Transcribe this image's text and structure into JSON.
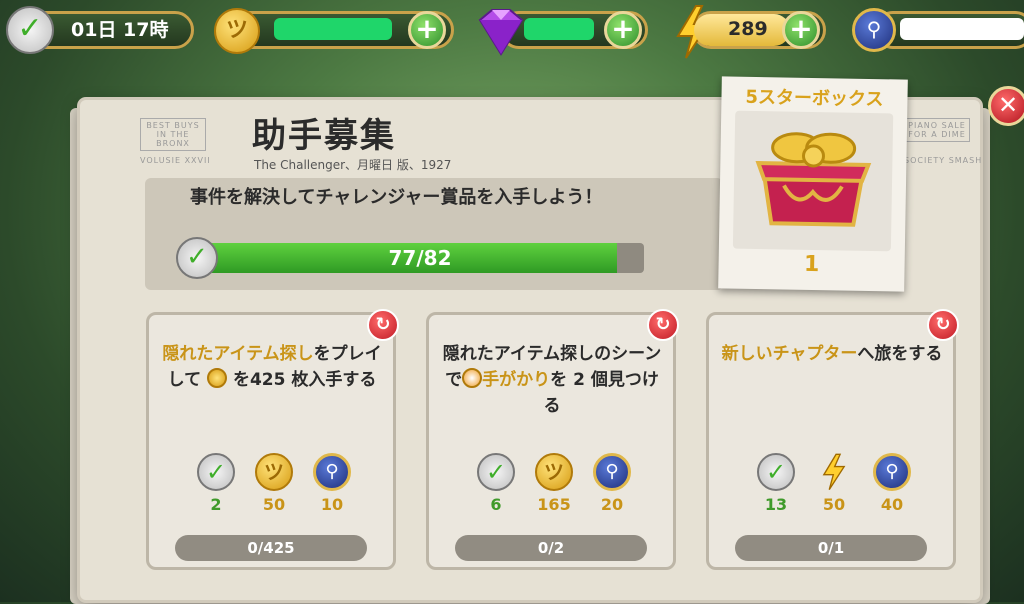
{
  "topbar": {
    "timer": "01日 17時",
    "energy": "289",
    "plus": "+"
  },
  "panel": {
    "title": "助手募集",
    "subtitle": "The Challenger、月曜日 版、1927",
    "description": "事件を解決してチャレンジャー賞品を入手しよう！",
    "progress_text": "77/82",
    "progress_fraction": 0.939,
    "masthead_left": "BEST BUYS IN THE BRONX",
    "masthead_left2": "VOLUSIE XXVII",
    "masthead_right": "PIANO SALE FOR A DIME",
    "masthead_right2": "SOCIETY SMASH"
  },
  "reward_box": {
    "title": "5スターボックス",
    "count": "1"
  },
  "tasks": [
    {
      "text_parts": [
        {
          "t": "隠れたアイテム探し",
          "gold": true
        },
        {
          "t": "をプレイして ",
          "gold": false
        },
        {
          "t": "COIN",
          "icon": true
        },
        {
          "t": " を",
          "gold": false
        },
        {
          "t": "425 枚入手する",
          "gold": false
        }
      ],
      "rewards": [
        {
          "icon": "xp-check-icon",
          "value": "2"
        },
        {
          "icon": "coin-icon",
          "value": "50"
        },
        {
          "icon": "magnifier-badge-icon",
          "value": "10"
        }
      ],
      "progress": "0/425"
    },
    {
      "text_parts": [
        {
          "t": "隠れたアイテム探し",
          "gold": false
        },
        {
          "t": "のシーンで",
          "gold": false
        },
        {
          "t": "HINT",
          "icon": true
        },
        {
          "t": "手が",
          "gold": true
        },
        {
          "t": "かり",
          "gold": true
        },
        {
          "t": "を 2 個見つける",
          "gold": false
        }
      ],
      "rewards": [
        {
          "icon": "xp-check-icon",
          "value": "6"
        },
        {
          "icon": "coin-icon",
          "value": "165"
        },
        {
          "icon": "magnifier-badge-icon",
          "value": "20"
        }
      ],
      "progress": "0/2"
    },
    {
      "text_parts": [
        {
          "t": "新しいチャプター",
          "gold": true
        },
        {
          "t": "へ",
          "gold": false
        },
        {
          "t": "旅をする",
          "gold": false
        }
      ],
      "rewards": [
        {
          "icon": "xp-check-icon",
          "value": "13"
        },
        {
          "icon": "energy-bolt-icon",
          "value": "50"
        },
        {
          "icon": "magnifier-badge-icon",
          "value": "40"
        }
      ],
      "progress": "0/1"
    }
  ],
  "colors": {
    "gold": "#c99418",
    "green_fill": "#3f9a2a",
    "redaction": "#1fd66a"
  }
}
